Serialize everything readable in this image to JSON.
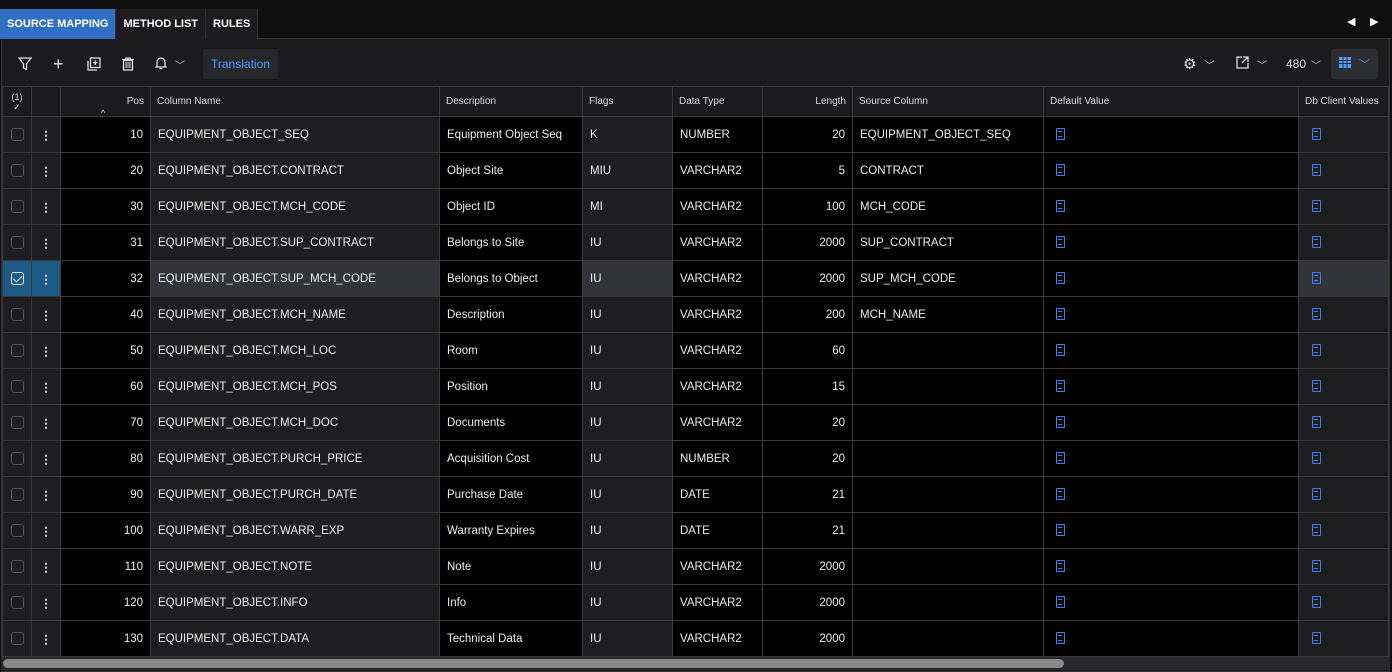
{
  "tabs": [
    "SOURCE MAPPING",
    "METHOD LIST",
    "RULES"
  ],
  "toolbar": {
    "translation_label": "Translation",
    "page_size": "480"
  },
  "header": {
    "selected_count": "(1)",
    "columns": [
      "Pos",
      "Column Name",
      "Description",
      "Flags",
      "Data Type",
      "Length",
      "Source Column",
      "Default Value",
      "Db Client Values"
    ]
  },
  "rows": [
    {
      "pos": "10",
      "col": "EQUIPMENT_OBJECT_SEQ",
      "desc": "Equipment Object Seq",
      "flags": "K",
      "type": "NUMBER",
      "len": "20",
      "src": "EQUIPMENT_OBJECT_SEQ"
    },
    {
      "pos": "20",
      "col": "EQUIPMENT_OBJECT.CONTRACT",
      "desc": "Object Site",
      "flags": "MIU",
      "type": "VARCHAR2",
      "len": "5",
      "src": "CONTRACT"
    },
    {
      "pos": "30",
      "col": "EQUIPMENT_OBJECT.MCH_CODE",
      "desc": "Object ID",
      "flags": "MI",
      "type": "VARCHAR2",
      "len": "100",
      "src": "MCH_CODE"
    },
    {
      "pos": "31",
      "col": "EQUIPMENT_OBJECT.SUP_CONTRACT",
      "desc": "Belongs to Site",
      "flags": "IU",
      "type": "VARCHAR2",
      "len": "2000",
      "src": "SUP_CONTRACT"
    },
    {
      "pos": "32",
      "col": "EQUIPMENT_OBJECT.SUP_MCH_CODE",
      "desc": "Belongs to Object",
      "flags": "IU",
      "type": "VARCHAR2",
      "len": "2000",
      "src": "SUP_MCH_CODE",
      "selected": true
    },
    {
      "pos": "40",
      "col": "EQUIPMENT_OBJECT.MCH_NAME",
      "desc": "Description",
      "flags": "IU",
      "type": "VARCHAR2",
      "len": "200",
      "src": "MCH_NAME"
    },
    {
      "pos": "50",
      "col": "EQUIPMENT_OBJECT.MCH_LOC",
      "desc": "Room",
      "flags": "IU",
      "type": "VARCHAR2",
      "len": "60",
      "src": ""
    },
    {
      "pos": "60",
      "col": "EQUIPMENT_OBJECT.MCH_POS",
      "desc": "Position",
      "flags": "IU",
      "type": "VARCHAR2",
      "len": "15",
      "src": ""
    },
    {
      "pos": "70",
      "col": "EQUIPMENT_OBJECT.MCH_DOC",
      "desc": "Documents",
      "flags": "IU",
      "type": "VARCHAR2",
      "len": "20",
      "src": ""
    },
    {
      "pos": "80",
      "col": "EQUIPMENT_OBJECT.PURCH_PRICE",
      "desc": "Acquisition Cost",
      "flags": "IU",
      "type": "NUMBER",
      "len": "20",
      "src": ""
    },
    {
      "pos": "90",
      "col": "EQUIPMENT_OBJECT.PURCH_DATE",
      "desc": "Purchase Date",
      "flags": "IU",
      "type": "DATE",
      "len": "21",
      "src": ""
    },
    {
      "pos": "100",
      "col": "EQUIPMENT_OBJECT.WARR_EXP",
      "desc": "Warranty Expires",
      "flags": "IU",
      "type": "DATE",
      "len": "21",
      "src": ""
    },
    {
      "pos": "110",
      "col": "EQUIPMENT_OBJECT.NOTE",
      "desc": "Note",
      "flags": "IU",
      "type": "VARCHAR2",
      "len": "2000",
      "src": ""
    },
    {
      "pos": "120",
      "col": "EQUIPMENT_OBJECT.INFO",
      "desc": "Info",
      "flags": "IU",
      "type": "VARCHAR2",
      "len": "2000",
      "src": ""
    },
    {
      "pos": "130",
      "col": "EQUIPMENT_OBJECT.DATA",
      "desc": "Technical Data",
      "flags": "IU",
      "type": "VARCHAR2",
      "len": "2000",
      "src": ""
    }
  ]
}
